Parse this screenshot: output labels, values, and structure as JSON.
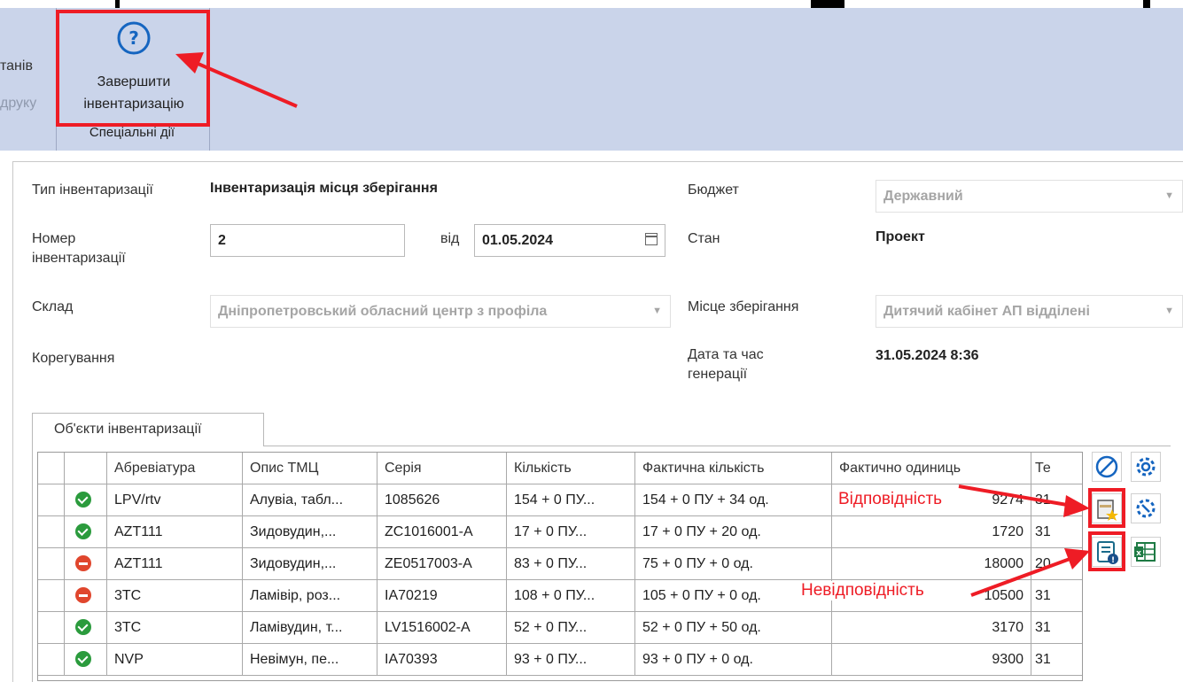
{
  "ribbon": {
    "left_fragment_1": "танів",
    "left_fragment_2": "друку",
    "finish_button": {
      "line1": "Завершити",
      "line2": "інвентаризацію",
      "icon": "help-circle-icon"
    },
    "group_label": "Спеціальні дії"
  },
  "form": {
    "type_label": "Тип інвентаризації",
    "type_value": "Інвентаризація місця зберігання",
    "budget_label": "Бюджет",
    "budget_value": "Державний",
    "number_label_1": "Номер",
    "number_label_2": "інвентаризації",
    "number_value": "2",
    "from_label": "від",
    "date_value": "01.05.2024",
    "state_label": "Стан",
    "state_value": "Проект",
    "warehouse_label": "Склад",
    "warehouse_value": "Дніпропетровський обласний центр з профіла",
    "storage_label": "Місце зберігання",
    "storage_value": "Дитячий кабінет АП відділені",
    "correction_label": "Корегування",
    "gen_label_1": "Дата та час",
    "gen_label_2": "генерації",
    "gen_value": "31.05.2024 8:36"
  },
  "tab": {
    "label": "Об'єкти інвентаризації"
  },
  "grid": {
    "columns": [
      "Абревіатура",
      "Опис ТМЦ",
      "Серія",
      "Кількість",
      "Фактична кількість",
      "Фактично одиниць",
      "Те"
    ],
    "rows": [
      {
        "status": "ok",
        "abbr": "LPV/rtv",
        "desc": "Алувіа, табл...",
        "series": "1085626",
        "qty": "154 + 0 ПУ...",
        "fact_qty": "154 + 0 ПУ + 34 од.",
        "fact_units": "9274",
        "t": "31"
      },
      {
        "status": "ok",
        "abbr": "AZT111",
        "desc": "Зидовудин,...",
        "series": "ZC1016001-A",
        "qty": "17 + 0 ПУ...",
        "fact_qty": "17 + 0 ПУ + 20 од.",
        "fact_units": "1720",
        "t": "31"
      },
      {
        "status": "no",
        "abbr": "AZT111",
        "desc": "Зидовудин,...",
        "series": "ZE0517003-A",
        "qty": "83 + 0 ПУ...",
        "fact_qty": "75 + 0 ПУ + 0 од.",
        "fact_units": "18000",
        "t": "20"
      },
      {
        "status": "no",
        "abbr": "3TC",
        "desc": "Ламівір, роз...",
        "series": "IA70219",
        "qty": "108 + 0 ПУ...",
        "fact_qty": "105 + 0 ПУ + 0 од.",
        "fact_units": "10500",
        "t": "31"
      },
      {
        "status": "ok",
        "abbr": "3TC",
        "desc": "Ламівудин, т...",
        "series": "LV1516002-A",
        "qty": "52 + 0 ПУ...",
        "fact_qty": "52 + 0 ПУ + 50 од.",
        "fact_units": "3170",
        "t": "31"
      },
      {
        "status": "ok",
        "abbr": "NVP",
        "desc": "Невімун, пе...",
        "series": "IA70393",
        "qty": "93 + 0 ПУ...",
        "fact_qty": "93 + 0 ПУ + 0 од.",
        "fact_units": "9300",
        "t": "31"
      }
    ]
  },
  "annotations": {
    "match": "Відповідність",
    "mismatch": "Невідповідність"
  },
  "colors": {
    "highlight": "#ee1c25",
    "ribbon_bg": "#cad4ea",
    "ok": "#2b9b3d",
    "no": "#e0462d"
  }
}
